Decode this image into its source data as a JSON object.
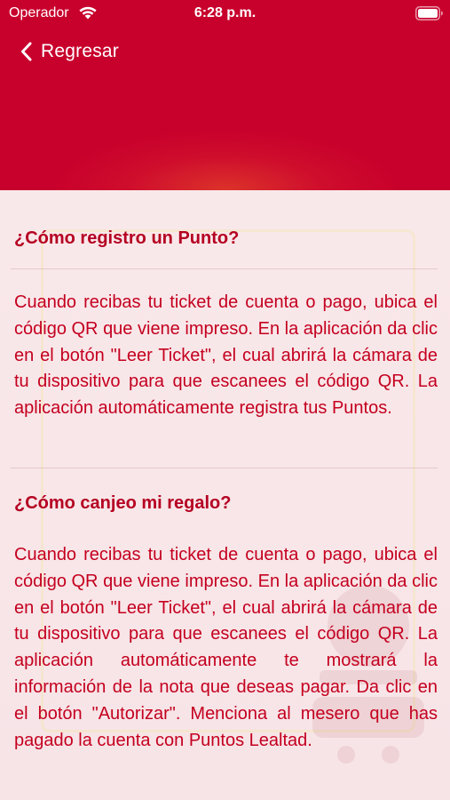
{
  "status_bar": {
    "carrier": "Operador",
    "time": "6:28 p.m.",
    "wifi_icon": "wifi-icon",
    "battery_icon": "battery-icon"
  },
  "nav": {
    "back_label": "Regresar",
    "back_icon": "chevron-left-icon"
  },
  "colors": {
    "header": "#c8002c",
    "text": "#c4001f",
    "background": "#f6e6e9"
  },
  "faq": [
    {
      "question": "¿Cómo registro un Punto?",
      "answer": "Cuando recibas tu ticket de cuenta o pago, ubica el código QR que viene impreso. En la aplicación da clic en el botón \"Leer Ticket\", el cual abrirá la cámara de tu dispositivo para que escanees el código QR. La aplicación automáticamente registra tus Puntos."
    },
    {
      "question": "¿Cómo canjeo mi regalo?",
      "answer": "Cuando recibas tu ticket de cuenta o pago, ubica el código QR que viene impreso. En la aplicación da clic en el botón \"Leer Ticket\", el cual abrirá la cámara de tu dispositivo para que escanees el código QR. La aplicación automáticamente te mostrará la información de la nota que deseas pagar. Da clic en el botón \"Autorizar\". Menciona al mesero que has pagado la cuenta con Puntos Lealtad."
    }
  ]
}
